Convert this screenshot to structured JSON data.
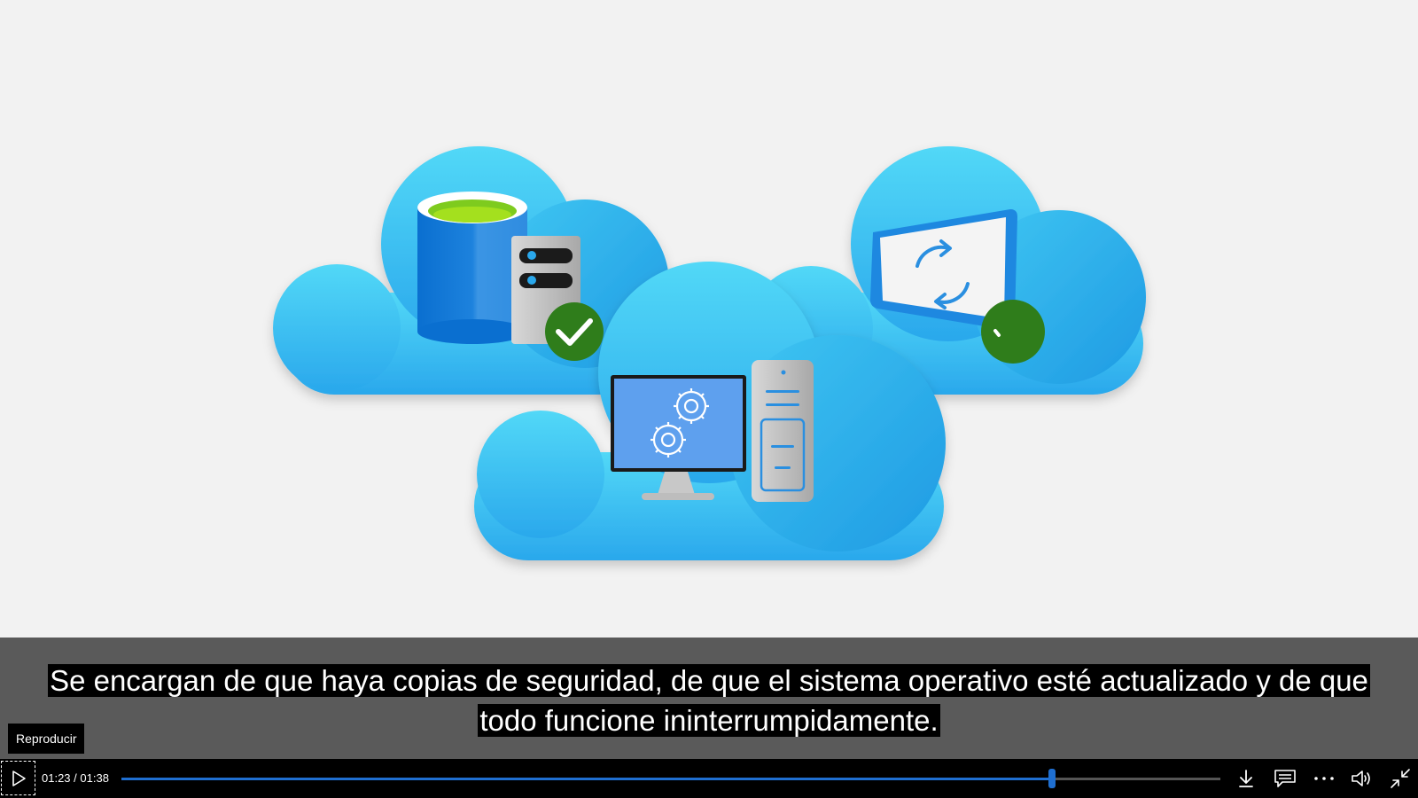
{
  "caption": {
    "line1": "Se encargan de que haya copias de seguridad, de que el sistema operativo esté actualizado y de que",
    "line2": "todo funcione ininterrumpidamente."
  },
  "tooltip": {
    "text": "Reproducir"
  },
  "player": {
    "current_time": "01:23",
    "separator": " / ",
    "total_time": "01:38",
    "progress_fraction": 0.847,
    "accent_color": "#1f6fd1"
  },
  "icons": {
    "play": "play-icon",
    "download": "download-icon",
    "captions": "captions-icon",
    "more": "more-options-icon",
    "volume": "volume-icon",
    "exit_fullscreen": "exit-fullscreen-icon"
  }
}
